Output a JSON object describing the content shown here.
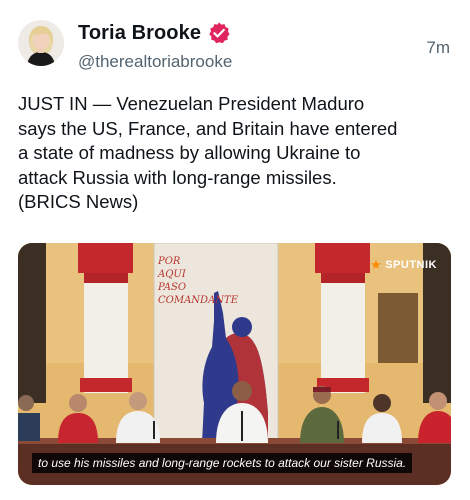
{
  "post": {
    "author_name": "Toria Brooke",
    "handle": "@therealtoriabrooke",
    "time": "7m",
    "verified_icon": "verified-badge-icon",
    "verified_color": "#e0245e",
    "text": "JUST IN — Venezuelan President Maduro\nsays the US, France, and Britain have entered\na state of madness by allowing Ukraine to\nattack Russia with long-range missiles.\n(BRICS News)"
  },
  "media": {
    "watermark": "SPUTNIK",
    "poster_text": "POR\nAQUI\nPASO\nCOMANDANTE",
    "caption": "to use his missiles and long-range rockets to attack our sister Russia."
  }
}
